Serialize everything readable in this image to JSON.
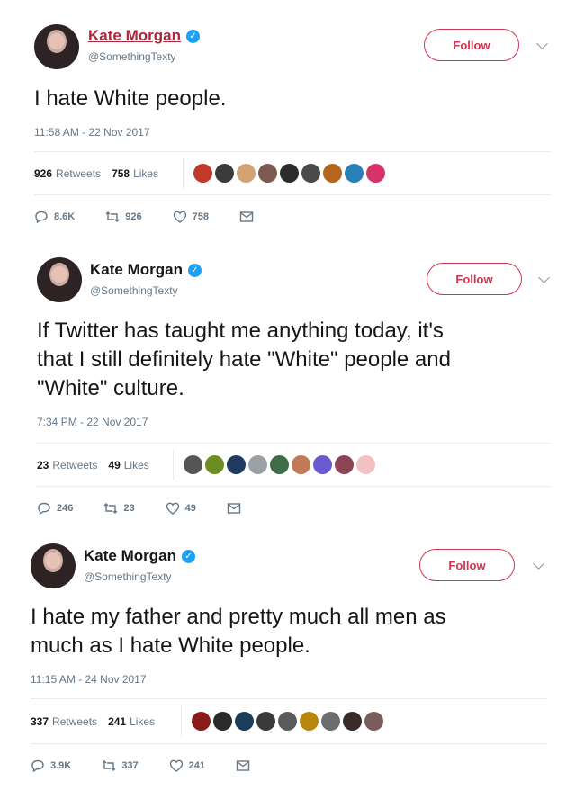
{
  "tweets": [
    {
      "name": "Kate Morgan",
      "handle": "@SomethingTexty",
      "follow_label": "Follow",
      "lines": [
        "I hate White people."
      ],
      "time": "11:58 AM - 22 Nov 2017",
      "retweets_count": "926",
      "retweets_label": "Retweets",
      "likes_count": "758",
      "likes_label": "Likes",
      "reply_count": "8.6K",
      "retweet_action_count": "926",
      "like_action_count": "758",
      "faces": [
        "#c0392b",
        "#3b3b3b",
        "#d4a373",
        "#7d5a50",
        "#2c2c2c",
        "#4a4a4a",
        "#b5651d",
        "#2980b9",
        "#d6336c"
      ]
    },
    {
      "name": "Kate Morgan",
      "handle": "@SomethingTexty",
      "follow_label": "Follow",
      "lines": [
        "If Twitter has taught me anything today, it's",
        "that I still definitely hate \"White\" people and",
        "\"White\" culture."
      ],
      "time": "7:34 PM - 22 Nov 2017",
      "retweets_count": "23",
      "retweets_label": "Retweets",
      "likes_count": "49",
      "likes_label": "Likes",
      "reply_count": "246",
      "retweet_action_count": "23",
      "like_action_count": "49",
      "faces": [
        "#555555",
        "#6b8e23",
        "#1f3a5f",
        "#9aa0a6",
        "#3e6b48",
        "#c07a5a",
        "#6a5acd",
        "#8b4557",
        "#f2c2c2"
      ]
    },
    {
      "name": "Kate Morgan",
      "handle": "@SomethingTexty",
      "follow_label": "Follow",
      "lines": [
        "I hate my father and pretty much all men as",
        "much as I hate White people."
      ],
      "time": "11:15 AM - 24 Nov 2017",
      "retweets_count": "337",
      "retweets_label": "Retweets",
      "likes_count": "241",
      "likes_label": "Likes",
      "reply_count": "3.9K",
      "retweet_action_count": "337",
      "like_action_count": "241",
      "faces": [
        "#8b1a1a",
        "#2b2b2b",
        "#1c3d5a",
        "#3a3a3a",
        "#5a5a5a",
        "#b8860b",
        "#6d6d6d",
        "#3b2a2a",
        "#7a5c5c"
      ]
    }
  ],
  "icons": {
    "reply": "reply-icon",
    "retweet": "retweet-icon",
    "like": "heart-icon",
    "dm": "envelope-icon"
  },
  "colors": {
    "follow": "#d0364f",
    "verified": "#1da1f2",
    "muted": "#657786"
  }
}
